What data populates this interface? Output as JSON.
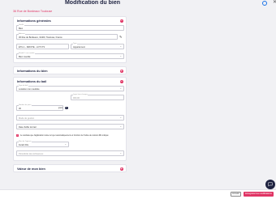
{
  "header": {
    "title": "Modification du bien",
    "help_icon": "help-circle-icon",
    "close_icon": "close-icon"
  },
  "property": {
    "address": "36 Rue de Bordeaux Toulouse"
  },
  "sections": {
    "general": {
      "title": "Informations générales",
      "fields": {
        "name": {
          "label": "Libellé",
          "value": "Bien"
        },
        "address": {
          "label": "Adresse",
          "value": "36 Rue de Bordeaux, 31400, Toulouse, France"
        },
        "lot": {
          "value": "ÉTG 1 - DROITE - LOT N°3"
        },
        "type": {
          "label": "Type",
          "value": "Appartement"
        },
        "furnished": {
          "label": "Meublé / non meublé",
          "value": "Bien meublé"
        }
      }
    },
    "property_info": {
      "title": "Informations du bien"
    },
    "lease_info": {
      "title": "Informations du bail",
      "fields": {
        "lease_type": {
          "label": "Type de bail",
          "value": "Location non meublée"
        },
        "rent": {
          "label": "Loyer hors charges",
          "value": "900,00"
        },
        "days": {
          "label": "Nombre de jours",
          "value": "30"
        },
        "unit": "jours",
        "field_a": {
          "value": "Mode de gestion"
        },
        "field_b": {
          "value": "Date d'effet du bail"
        },
        "agency_name": {
          "label": "Nom de l'agence",
          "value": "Ferahi Fils"
        },
        "field_c": {
          "value": "Périodicité des échéances"
        }
      },
      "checkbox_label": "Je souhaite que l'application révise le loyer automatiquement en fonction de l'indice de révision IRL indiqué"
    },
    "value": {
      "title": "Valeur de mon bien"
    }
  },
  "footer": {
    "cancel_label": "Annuler",
    "save_label": "Enregistrer les modifications"
  },
  "colors": {
    "accent": "#e03565",
    "navy": "#1e2240"
  }
}
